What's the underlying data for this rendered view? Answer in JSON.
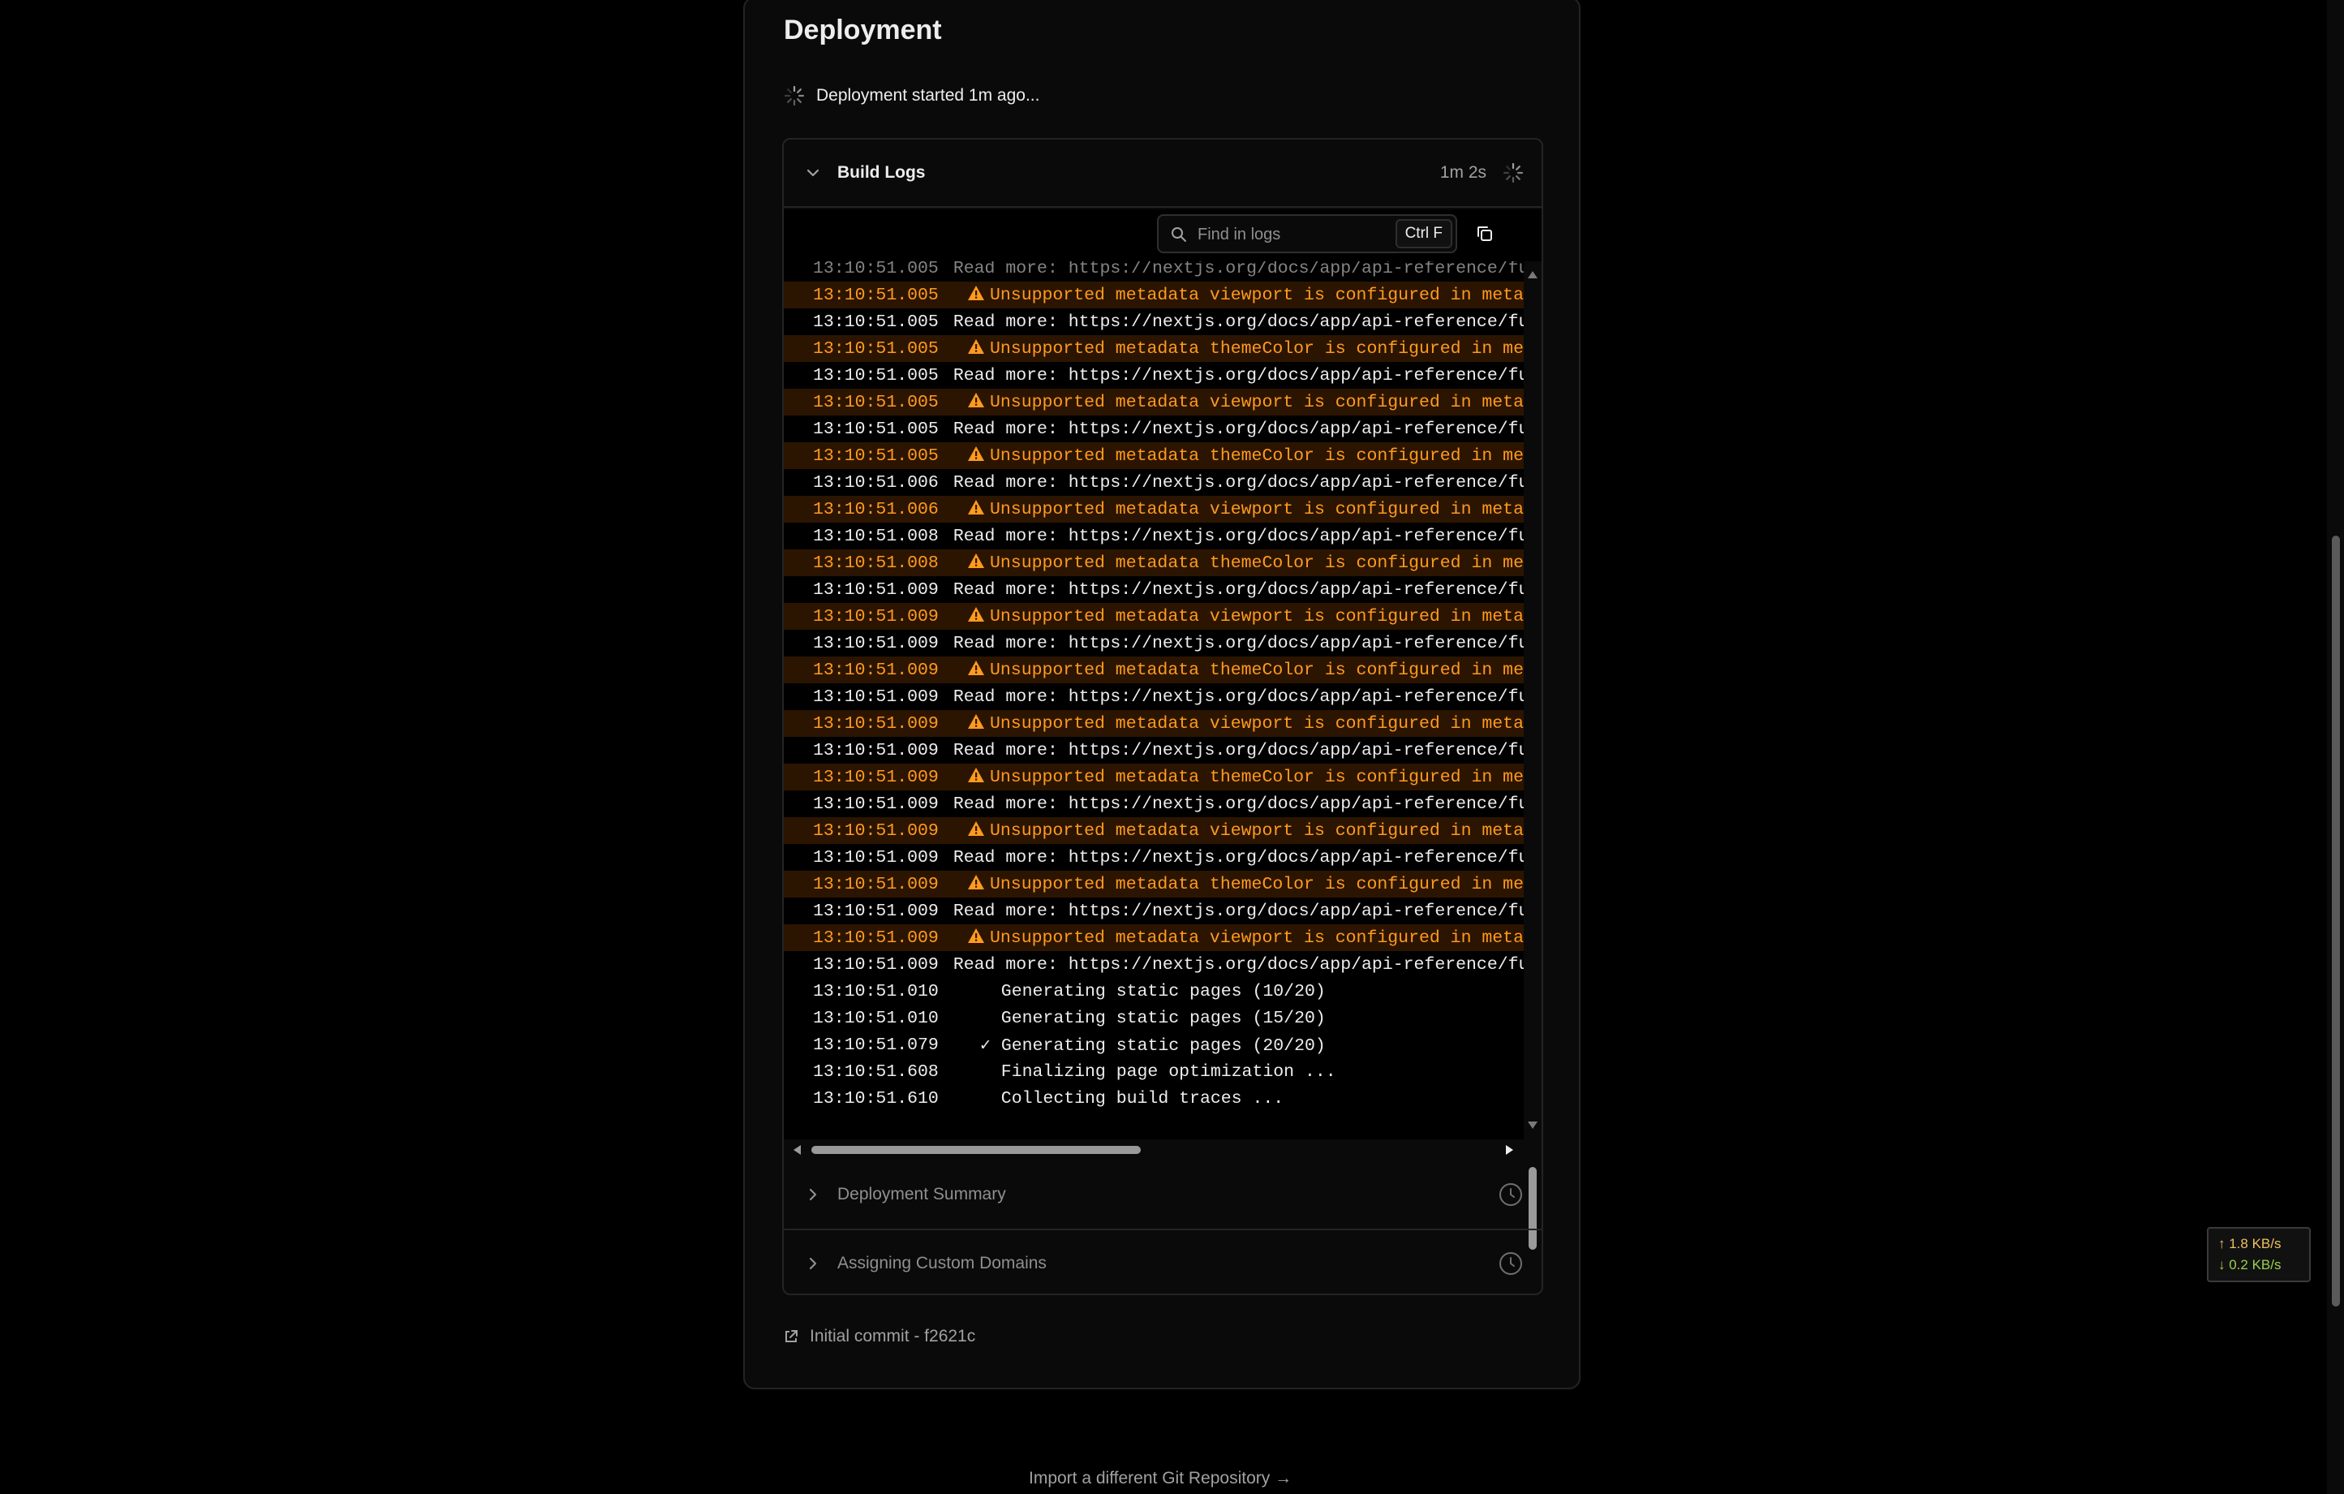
{
  "page": {
    "title": "Deployment"
  },
  "status": {
    "text": "Deployment started 1m ago..."
  },
  "build_logs": {
    "title": "Build Logs",
    "elapsed": "1m 2s",
    "search_placeholder": "Find in logs",
    "shortcut": "Ctrl F",
    "lines": [
      {
        "time": "13:10:51.005",
        "text": "Read more: https://nextjs.org/docs/app/api-reference/fu",
        "type": "faded"
      },
      {
        "time": "13:10:51.005",
        "text": "Unsupported metadata viewport is configured in meta",
        "type": "warn"
      },
      {
        "time": "13:10:51.005",
        "text": "Read more: https://nextjs.org/docs/app/api-reference/fu",
        "type": "info"
      },
      {
        "time": "13:10:51.005",
        "text": "Unsupported metadata themeColor is configured in me",
        "type": "warn"
      },
      {
        "time": "13:10:51.005",
        "text": "Read more: https://nextjs.org/docs/app/api-reference/fu",
        "type": "info"
      },
      {
        "time": "13:10:51.005",
        "text": "Unsupported metadata viewport is configured in meta",
        "type": "warn"
      },
      {
        "time": "13:10:51.005",
        "text": "Read more: https://nextjs.org/docs/app/api-reference/fu",
        "type": "info"
      },
      {
        "time": "13:10:51.005",
        "text": "Unsupported metadata themeColor is configured in me",
        "type": "warn"
      },
      {
        "time": "13:10:51.006",
        "text": "Read more: https://nextjs.org/docs/app/api-reference/fu",
        "type": "info"
      },
      {
        "time": "13:10:51.006",
        "text": "Unsupported metadata viewport is configured in meta",
        "type": "warn"
      },
      {
        "time": "13:10:51.008",
        "text": "Read more: https://nextjs.org/docs/app/api-reference/fu",
        "type": "info"
      },
      {
        "time": "13:10:51.008",
        "text": "Unsupported metadata themeColor is configured in me",
        "type": "warn"
      },
      {
        "time": "13:10:51.009",
        "text": "Read more: https://nextjs.org/docs/app/api-reference/fu",
        "type": "info"
      },
      {
        "time": "13:10:51.009",
        "text": "Unsupported metadata viewport is configured in meta",
        "type": "warn"
      },
      {
        "time": "13:10:51.009",
        "text": "Read more: https://nextjs.org/docs/app/api-reference/fu",
        "type": "info"
      },
      {
        "time": "13:10:51.009",
        "text": "Unsupported metadata themeColor is configured in me",
        "type": "warn"
      },
      {
        "time": "13:10:51.009",
        "text": "Read more: https://nextjs.org/docs/app/api-reference/fu",
        "type": "info"
      },
      {
        "time": "13:10:51.009",
        "text": "Unsupported metadata viewport is configured in meta",
        "type": "warn"
      },
      {
        "time": "13:10:51.009",
        "text": "Read more: https://nextjs.org/docs/app/api-reference/fu",
        "type": "info"
      },
      {
        "time": "13:10:51.009",
        "text": "Unsupported metadata themeColor is configured in me",
        "type": "warn"
      },
      {
        "time": "13:10:51.009",
        "text": "Read more: https://nextjs.org/docs/app/api-reference/fu",
        "type": "info"
      },
      {
        "time": "13:10:51.009",
        "text": "Unsupported metadata viewport is configured in meta",
        "type": "warn"
      },
      {
        "time": "13:10:51.009",
        "text": "Read more: https://nextjs.org/docs/app/api-reference/fu",
        "type": "info"
      },
      {
        "time": "13:10:51.009",
        "text": "Unsupported metadata themeColor is configured in me",
        "type": "warn"
      },
      {
        "time": "13:10:51.009",
        "text": "Read more: https://nextjs.org/docs/app/api-reference/fu",
        "type": "info"
      },
      {
        "time": "13:10:51.009",
        "text": "Unsupported metadata viewport is configured in meta",
        "type": "warn"
      },
      {
        "time": "13:10:51.009",
        "text": "Read more: https://nextjs.org/docs/app/api-reference/fu",
        "type": "info"
      },
      {
        "time": "13:10:51.010",
        "text": "  Generating static pages (10/20)",
        "type": "info"
      },
      {
        "time": "13:10:51.010",
        "text": "  Generating static pages (15/20)",
        "type": "info"
      },
      {
        "time": "13:10:51.079",
        "text": "✓ Generating static pages (20/20)",
        "type": "info"
      },
      {
        "time": "13:10:51.608",
        "text": "  Finalizing page optimization ...",
        "type": "info"
      },
      {
        "time": "13:10:51.610",
        "text": "  Collecting build traces ...",
        "type": "info"
      }
    ]
  },
  "sections": [
    {
      "title": "Deployment Summary",
      "icon": "clock-icon"
    },
    {
      "title": "Assigning Custom Domains",
      "icon": "clock-icon"
    }
  ],
  "commit": {
    "text": "Initial commit - f2621c"
  },
  "footer": {
    "import_link": "Import a different Git Repository →"
  },
  "netspeed": {
    "up": "↑ 1.8 KB/s",
    "down": "↓ 0.2 KB/s"
  },
  "colors": {
    "warning": "#ff9a1f",
    "warning_bg": "#2c1500",
    "background": "#000000",
    "card": "#0a0a0a"
  }
}
